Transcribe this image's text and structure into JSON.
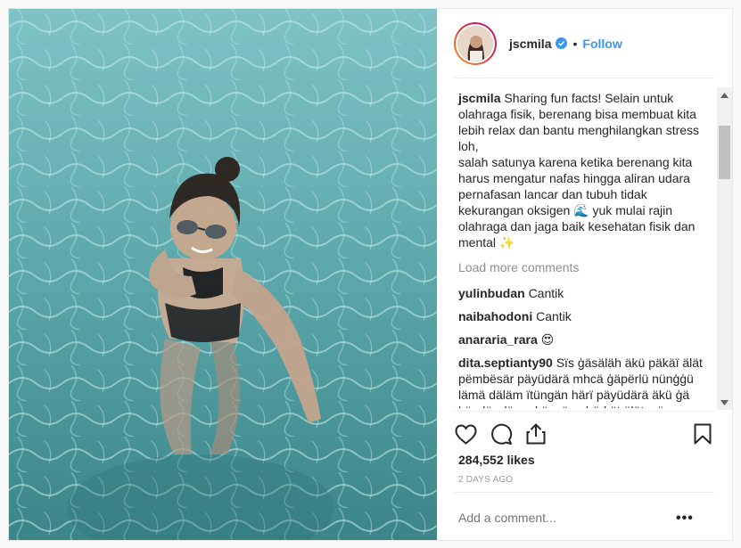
{
  "post": {
    "username": "jscmila",
    "follow_label": "Follow",
    "separator": "•",
    "caption_username": "jscmila",
    "caption_text": "Sharing fun facts! Selain untuk olahraga fisik, berenang bisa membuat kita lebih relax dan bantu menghilangkan stress loh,\nsalah satunya karena ketika berenang kita harus mengatur nafas hingga aliran udara pernafasan lancar dan tubuh tidak kekurangan oksigen 🌊 yuk mulai rajin olahraga dan jaga baik kesehatan fisik dan mental ✨",
    "load_more": "Load more comments",
    "comments": [
      {
        "user": "yulinbudan",
        "text": "Cantik"
      },
      {
        "user": "naibahodoni",
        "text": "Cantik"
      },
      {
        "user": "anararia_rara",
        "text": "😍"
      },
      {
        "user": "dita.septianty90",
        "text": "Sïs ģäsäläh äkü päkäï älät pëmbësär päyüdärä mhcä ģäpërlü nünģģü lämä däläm ïtüngän härï päyüdärä äkü ģä këndör dän + këncëng bërkät älätnyä"
      }
    ],
    "likes": "284,552 likes",
    "time": "2 DAYS AGO",
    "add_comment_placeholder": "Add a comment...",
    "more_options": "•••"
  },
  "icons": [
    "verified-badge-icon",
    "heart-icon",
    "comment-icon",
    "share-icon",
    "bookmark-icon",
    "more-options-icon"
  ],
  "colors": {
    "link": "#3897f0",
    "muted": "#8e8e8e",
    "text": "#262626"
  }
}
